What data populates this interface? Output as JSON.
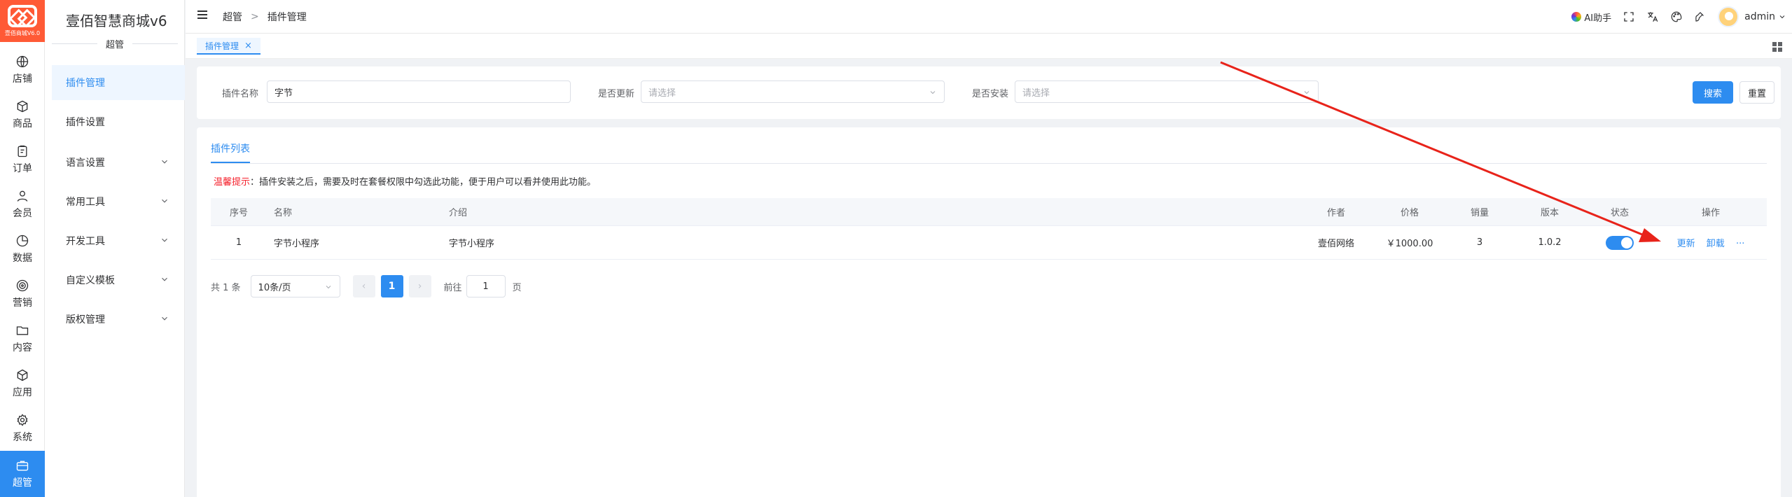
{
  "brand": {
    "logo_text": "壹佰商城V6.0",
    "app_title": "壹佰智慧商城v6",
    "accent": "#2d8cf0",
    "logo_color": "#ff5a36"
  },
  "rail": [
    {
      "label": "店铺",
      "icon": "globe-icon"
    },
    {
      "label": "商品",
      "icon": "box-icon"
    },
    {
      "label": "订单",
      "icon": "clipboard-icon"
    },
    {
      "label": "会员",
      "icon": "user-icon"
    },
    {
      "label": "数据",
      "icon": "pie-chart-icon"
    },
    {
      "label": "营销",
      "icon": "target-icon"
    },
    {
      "label": "内容",
      "icon": "folder-icon"
    },
    {
      "label": "应用",
      "icon": "cube-icon"
    },
    {
      "label": "系统",
      "icon": "gear-icon"
    },
    {
      "label": "超管",
      "icon": "briefcase-icon",
      "active": true
    }
  ],
  "submenu": {
    "group_title": "超管",
    "items": [
      {
        "label": "插件管理",
        "active": true
      },
      {
        "label": "插件设置"
      },
      {
        "label": "语言设置",
        "expandable": true
      },
      {
        "label": "常用工具",
        "expandable": true
      },
      {
        "label": "开发工具",
        "expandable": true
      },
      {
        "label": "自定义模板",
        "expandable": true
      },
      {
        "label": "版权管理",
        "expandable": true
      }
    ]
  },
  "header": {
    "breadcrumb": [
      "超管",
      "插件管理"
    ],
    "breadcrumb_separator": ">",
    "ai_label": "AI助手",
    "username": "admin"
  },
  "tabs": [
    {
      "label": "插件管理",
      "close": "×"
    }
  ],
  "filters": {
    "name_label": "插件名称",
    "name_value": "字节",
    "update_label": "是否更新",
    "update_placeholder": "请选择",
    "install_label": "是否安装",
    "install_placeholder": "请选择",
    "search_button": "搜索",
    "reset_button": "重置"
  },
  "list": {
    "tab_label": "插件列表",
    "tip_label": "温馨提示",
    "tip_colon": "：",
    "tip_text": "插件安装之后，需要及时在套餐权限中勾选此功能，便于用户可以看并使用此功能。",
    "columns": {
      "no": "序号",
      "name": "名称",
      "intro": "介绍",
      "author": "作者",
      "price": "价格",
      "sales": "销量",
      "version": "版本",
      "status": "状态",
      "ops": "操作"
    },
    "rows": [
      {
        "no": "1",
        "name": "字节小程序",
        "intro": "字节小程序",
        "author": "壹佰网络",
        "price": "￥1000.00",
        "sales": "3",
        "version": "1.0.2",
        "enabled": true,
        "op_update": "更新",
        "op_uninstall": "卸载",
        "op_more": "···"
      }
    ]
  },
  "pagination": {
    "total_text": "共 1 条",
    "page_size": "10条/页",
    "prev": "‹",
    "current": "1",
    "next": "›",
    "jump_prefix": "前往",
    "jump_value": "1",
    "jump_suffix": "页"
  }
}
